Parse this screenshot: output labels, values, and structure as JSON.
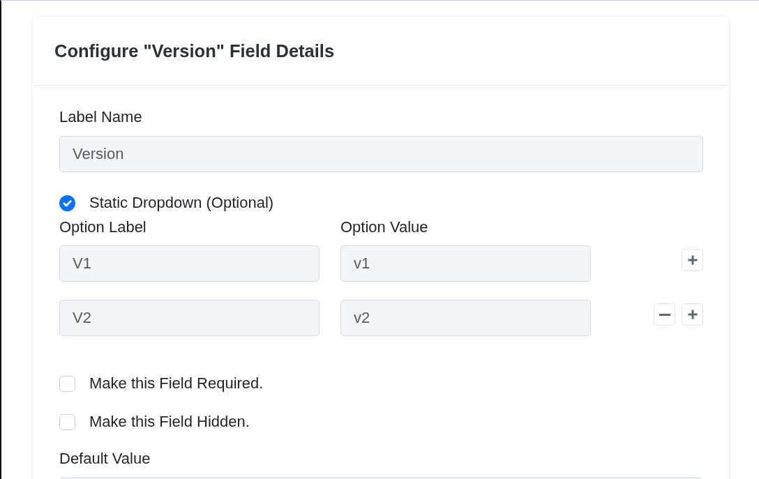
{
  "card": {
    "title": "Configure \"Version\" Field Details"
  },
  "label_name": {
    "label": "Label Name",
    "value": "Version"
  },
  "static_dropdown": {
    "label": "Static Dropdown (Optional)",
    "checked": true
  },
  "options": {
    "columns": [
      "Option Label",
      "Option Value"
    ],
    "rows": [
      {
        "label": "V1",
        "value": "v1",
        "removable": false
      },
      {
        "label": "V2",
        "value": "v2",
        "removable": true
      }
    ]
  },
  "checkboxes": [
    {
      "label": "Make this Field Required.",
      "checked": false
    },
    {
      "label": "Make this Field Hidden.",
      "checked": false
    }
  ],
  "default_value": {
    "label": "Default Value"
  }
}
